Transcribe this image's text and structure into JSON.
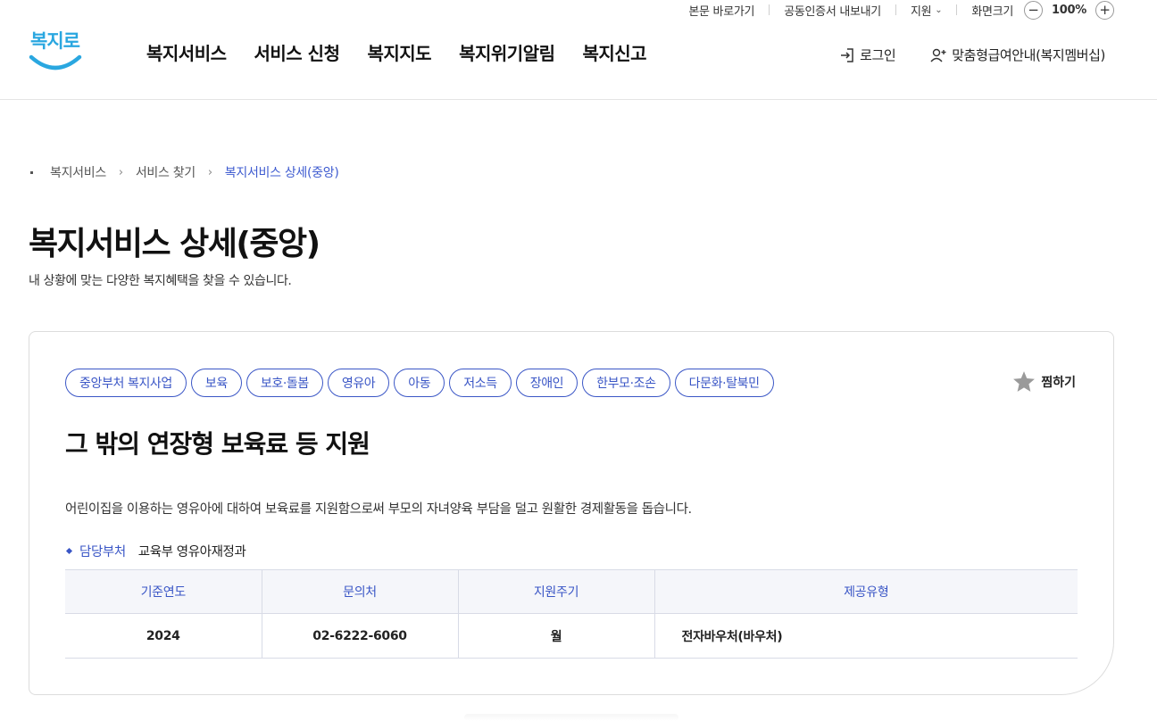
{
  "utility": {
    "skip_link": "본문 바로가기",
    "cert_export": "공동인증서 내보내기",
    "support": "지원",
    "zoom_label": "화면크기",
    "zoom_minus": "−",
    "zoom_value": "100%",
    "zoom_plus": "+"
  },
  "logo": {
    "text": "복지로"
  },
  "gnb": {
    "items": [
      "복지서비스",
      "서비스 신청",
      "복지지도",
      "복지위기알림",
      "복지신고"
    ]
  },
  "member": {
    "login": "로그인",
    "membership": "맞춤형급여안내(복지멤버십)"
  },
  "breadcrumb": {
    "items": [
      "복지서비스",
      "서비스 찾기",
      "복지서비스 상세(중앙)"
    ]
  },
  "page": {
    "title": "복지서비스 상세(중앙)",
    "description": "내 상황에 맞는 다양한 복지혜택을 찾을 수 있습니다."
  },
  "service": {
    "tags": [
      "중앙부처 복지사업",
      "보육",
      "보호·돌봄",
      "영유아",
      "아동",
      "저소득",
      "장애인",
      "한부모·조손",
      "다문화·탈북민"
    ],
    "favorite_label": "찜하기",
    "title": "그 밖의 연장형 보육료 등 지원",
    "description": "어린이집을 이용하는 영유아에 대하여 보육료를 지원함으로써 부모의 자녀양육 부담을 덜고 원활한 경제활동을 돕습니다.",
    "dept_label": "담당부처",
    "dept_value": "교육부 영유아재정과",
    "table": {
      "headers": [
        "기준연도",
        "문의처",
        "지원주기",
        "제공유형"
      ],
      "row": [
        "2024",
        "02-6222-6060",
        "월",
        "전자바우처(바우처)"
      ]
    }
  },
  "colors": {
    "accent": "#3a56c6",
    "logo": "#2aa7e0"
  }
}
